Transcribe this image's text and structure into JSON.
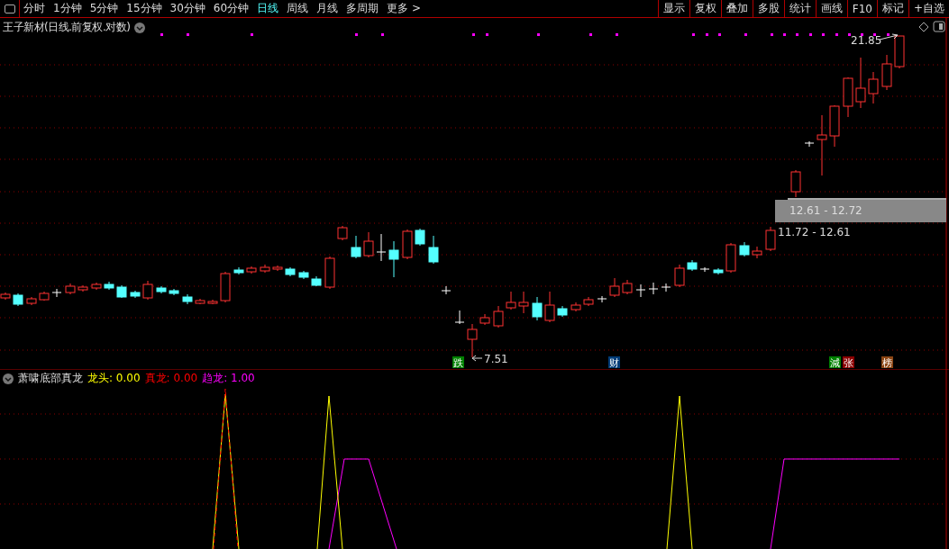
{
  "toolbar": {
    "periods": [
      {
        "label": "分时",
        "selected": false
      },
      {
        "label": "1分钟",
        "selected": false
      },
      {
        "label": "5分钟",
        "selected": false
      },
      {
        "label": "15分钟",
        "selected": false
      },
      {
        "label": "30分钟",
        "selected": false
      },
      {
        "label": "60分钟",
        "selected": false
      },
      {
        "label": "日线",
        "selected": true
      },
      {
        "label": "周线",
        "selected": false
      },
      {
        "label": "月线",
        "selected": false
      },
      {
        "label": "多周期",
        "selected": false
      },
      {
        "label": "更多 >",
        "selected": false
      }
    ],
    "buttons": [
      "显示",
      "复权",
      "叠加",
      "多股",
      "统计",
      "画线",
      "F10",
      "标记",
      "+自选"
    ]
  },
  "chart": {
    "title": "王子新材(日线.前复权.对数)",
    "high_label": "21.85",
    "low_label": "7.51",
    "band_label": "12.61 - 12.72",
    "range_label": "11.72 - 12.61",
    "markers": [
      {
        "text": "跌",
        "color": "#008000"
      },
      {
        "text": "财",
        "color": "#003c78"
      },
      {
        "text": "減",
        "color": "#008000"
      },
      {
        "text": "张",
        "color": "#8b0000"
      },
      {
        "text": "榜",
        "color": "#8b4513"
      }
    ]
  },
  "indicator": {
    "name": "萧啸底部真龙",
    "values": [
      {
        "label": "龙头:",
        "value": "0.00",
        "color": "#ffff00"
      },
      {
        "label": "真龙:",
        "value": "0.00",
        "color": "#ff0000"
      },
      {
        "label": "趋龙:",
        "value": "1.00",
        "color": "#ff00ff"
      }
    ]
  }
}
